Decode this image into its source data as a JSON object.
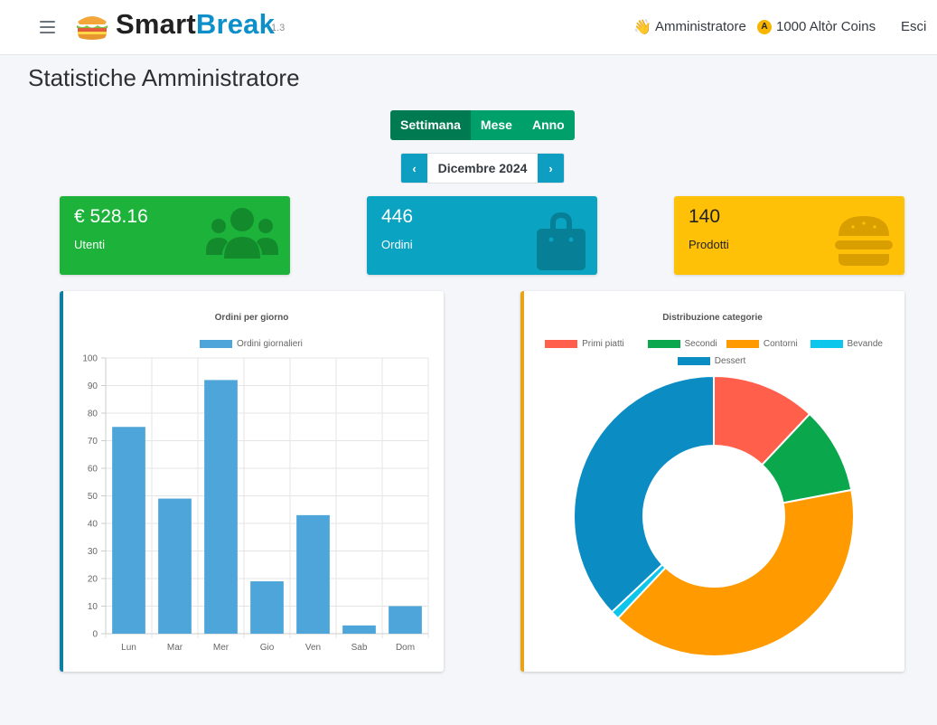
{
  "navbar": {
    "brand_part1": "Smart",
    "brand_part2": "Break",
    "version": "1.3",
    "user_label": "Amministratore",
    "coins_label": "1000 Altòr Coins",
    "coin_letter": "A",
    "logout_label": "Esci"
  },
  "page": {
    "title": "Statistiche Amministratore"
  },
  "period_tabs": [
    {
      "label": "Settimana",
      "active": true
    },
    {
      "label": "Mese",
      "active": false
    },
    {
      "label": "Anno",
      "active": false
    }
  ],
  "date_nav": {
    "prev_symbol": "‹",
    "current": "Dicembre 2024",
    "next_symbol": "›"
  },
  "stats": [
    {
      "value": "€ 528.16",
      "label": "Utenti",
      "color": "#1db33b",
      "icon": "users-icon"
    },
    {
      "value": "446",
      "label": "Ordini",
      "color": "#0aa3c2",
      "icon": "shopping-bag-icon"
    },
    {
      "value": "140",
      "label": "Prodotti",
      "color": "#ffc107",
      "icon": "burger-icon"
    }
  ],
  "chart_data": [
    {
      "type": "bar",
      "title": "Ordini per giorno",
      "categories": [
        "Lun",
        "Mar",
        "Mer",
        "Gio",
        "Ven",
        "Sab",
        "Dom"
      ],
      "series": [
        {
          "name": "Ordini giornalieri",
          "values": [
            75,
            49,
            92,
            19,
            43,
            3,
            10
          ],
          "color": "#4ea5d9"
        }
      ],
      "ylim": [
        0,
        100
      ],
      "yticks": [
        0,
        10,
        20,
        30,
        40,
        50,
        60,
        70,
        80,
        90,
        100
      ],
      "grid": true,
      "legend": "top",
      "accent": "#0e7fa3"
    },
    {
      "type": "pie",
      "title": "Distribuzione categorie",
      "labels": [
        "Primi piatti",
        "Secondi",
        "Contorni",
        "Bevande",
        "Dessert"
      ],
      "values": [
        12,
        10,
        40,
        1,
        37
      ],
      "colors": [
        "#ff5f4b",
        "#0aa74c",
        "#ff9a00",
        "#0cc6ec",
        "#0b8dc4"
      ],
      "donut": true,
      "legend": "top",
      "accent": "#e8a317"
    }
  ]
}
